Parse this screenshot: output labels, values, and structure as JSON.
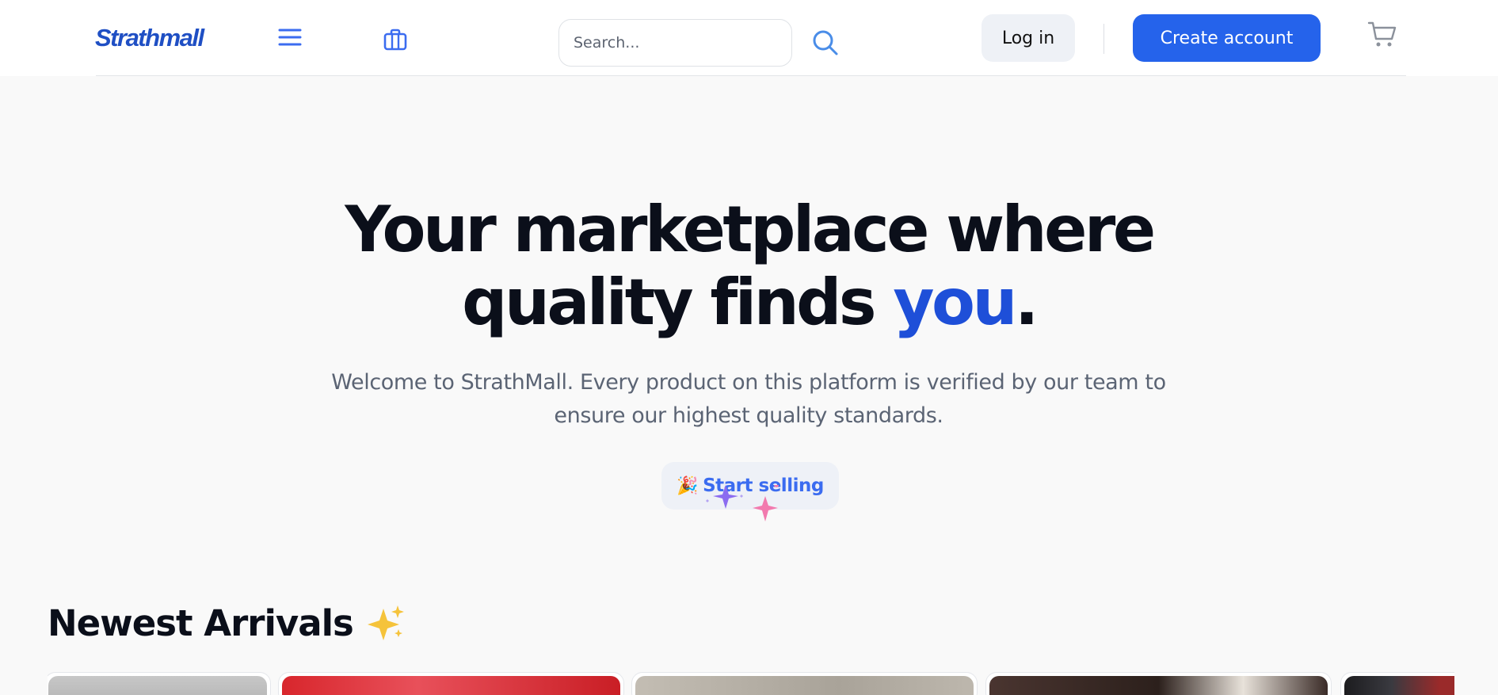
{
  "header": {
    "logo": "Strathmall",
    "search_placeholder": "Search...",
    "login_label": "Log in",
    "create_account_label": "Create account",
    "icons": [
      "menu-icon",
      "briefcase-icon",
      "search-icon",
      "cart-icon"
    ],
    "accent_color": "#2563eb"
  },
  "hero": {
    "title_line1": "Your marketplace where",
    "title_line2_prefix": "quality finds ",
    "title_accent": "you",
    "title_suffix": ".",
    "subtitle": "Welcome to StrathMall. Every product on this platform is verified by our team to ensure our highest quality standards.",
    "cta_label": "Start selling",
    "cta_icon": "party-popper-icon"
  },
  "arrivals": {
    "title": "Newest Arrivals",
    "title_icon": "sparkles-icon",
    "cards": [
      {
        "name": "product-card-1",
        "color": "#b9b9b9"
      },
      {
        "name": "product-card-2",
        "color": "#d42a2f"
      },
      {
        "name": "product-card-3",
        "color": "#b7b1a8"
      },
      {
        "name": "product-card-4",
        "color": "#3a2a26"
      },
      {
        "name": "product-card-5",
        "color": "#2a2a2e"
      }
    ]
  }
}
